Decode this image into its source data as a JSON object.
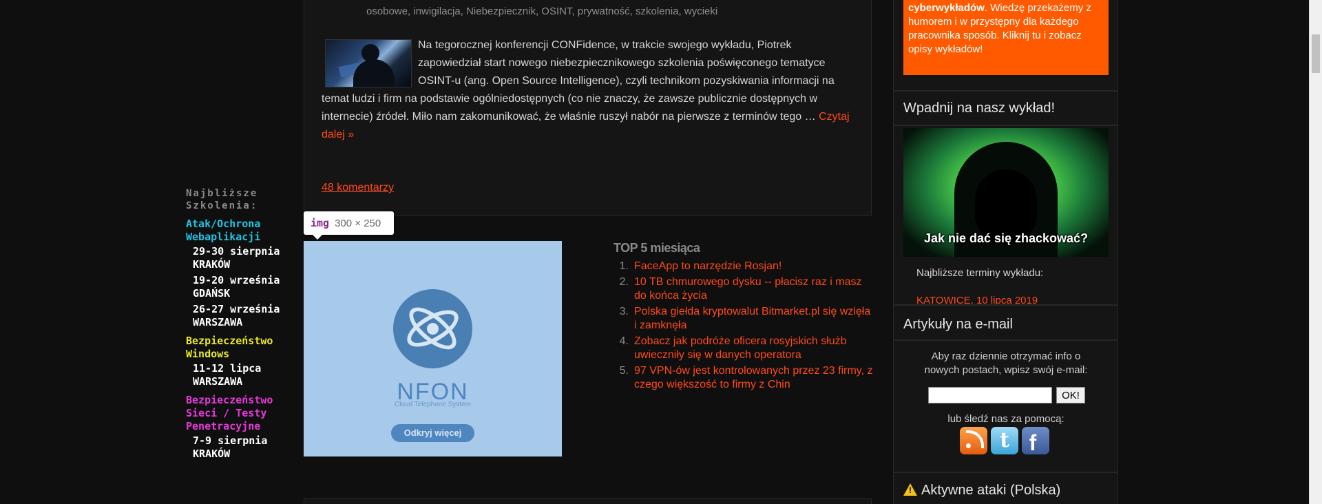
{
  "trainings": {
    "header": "Najbliższe Szkolenia:",
    "categories": [
      {
        "title": "Atak/Ochrona Webaplikacji",
        "color": "#22c3e6",
        "dates": [
          "29-30 sierpnia KRAKÓW",
          "19-20 września GDAŃSK",
          "26-27 września WARSZAWA"
        ]
      },
      {
        "title": "Bezpieczeństwo Windows",
        "color": "#e8e82a",
        "dates": [
          "11-12 lipca WARSZAWA"
        ]
      },
      {
        "title": "Bezpieczeństwo Sieci / Testy Penetracyjne",
        "color": "#e43ad9",
        "dates": [
          "7-9 sierpnia KRAKÓW"
        ]
      }
    ]
  },
  "article": {
    "tags": "osobowe, inwigilacja, Niebezpiecznik, OSINT, prywatność, szkolenia, wycieki",
    "excerpt": "Na tegorocznej konferencji CONFidence, w trakcie swojego wykładu, Piotrek zapowiedział start nowego niebezpiecznikowego szkolenia poświęconego tematyce OSINT-u (ang. Open Source Intelligence), czyli technikom pozyskiwania informacji na temat ludzi i firm na podstawie ogólniedostępnych (co nie znaczy, że zawsze publicznie dostępnych w internecie) źródeł. Miło nam zakomunikować, że właśnie ruszył nabór na pierwsze z terminów tego …",
    "read_more": "Czytaj dalej »",
    "comments": "48 komentarzy"
  },
  "inspector_tooltip": {
    "tag": "img",
    "size": "300 × 250"
  },
  "ad": {
    "brand": "NFON",
    "tagline": "Cloud Telephone System",
    "cta": "Odkryj więcej"
  },
  "top5": {
    "title": "TOP 5 miesiąca",
    "items": [
      {
        "num": "1.",
        "title": "FaceApp to narzędzie Rosjan!"
      },
      {
        "num": "2.",
        "title": "10 TB chmurowego dysku -- płacisz raz i masz do końca życia"
      },
      {
        "num": "3.",
        "title": "Polska giełda kryptowalut Bitmarket.pl się wzięła i zamknęła"
      },
      {
        "num": "4.",
        "title": "Zobacz jak podróże oficera rosyjskich służb uwieczniły się w danych operatora"
      },
      {
        "num": "5.",
        "title": "97 VPN-ów jest kontrolowanych przez 23 firmy, z czego większość to firmy z Chin"
      }
    ]
  },
  "sidebar": {
    "promo_bold": "cyberwykładów",
    "promo_text": ". Wiedzę przekażemy z humorem i w przystępny dla każdego pracownika sposób. Kliknij tu i zobacz opisy wykładów!",
    "lecture_heading": "Wpadnij na nasz wykład!",
    "lecture_image_caption": "Jak nie dać się zhackować?",
    "next_dates_label": "Najbliższe terminy wykładu:",
    "next_city": "KATOWICE, 10 lipca 2019",
    "email_heading": "Artykuły na e-mail",
    "email_text": "Aby raz dziennie otrzymać info o nowych postach, wpisz swój e-mail:",
    "email_button": "OK!",
    "follow_text": "lub śledź nas za pomocą:",
    "tw_glyph": "t",
    "fb_glyph": "f",
    "attacks_heading": "Aktywne ataki (Polska)"
  }
}
